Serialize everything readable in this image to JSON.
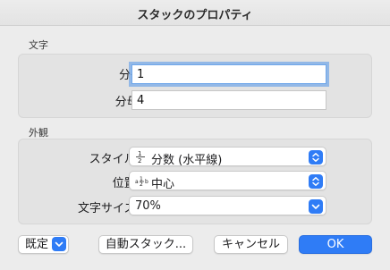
{
  "window": {
    "title": "スタックのプロパティ"
  },
  "text_section": {
    "heading": "文字",
    "numerator_label": "分子",
    "numerator_value": "1",
    "denominator_label": "分母:",
    "denominator_value": "4"
  },
  "appearance_section": {
    "heading": "外観",
    "style_label": "スタイル:",
    "style_value": "分数 (水平線)",
    "position_label": "位置:",
    "position_value": "中心",
    "size_label": "文字サイズ:",
    "size_value": "70%"
  },
  "footer": {
    "defaults_label": "既定",
    "auto_stack_label": "自動スタック...",
    "cancel_label": "キャンセル",
    "ok_label": "OK"
  },
  "colors": {
    "accent": "#2f7cf6"
  }
}
